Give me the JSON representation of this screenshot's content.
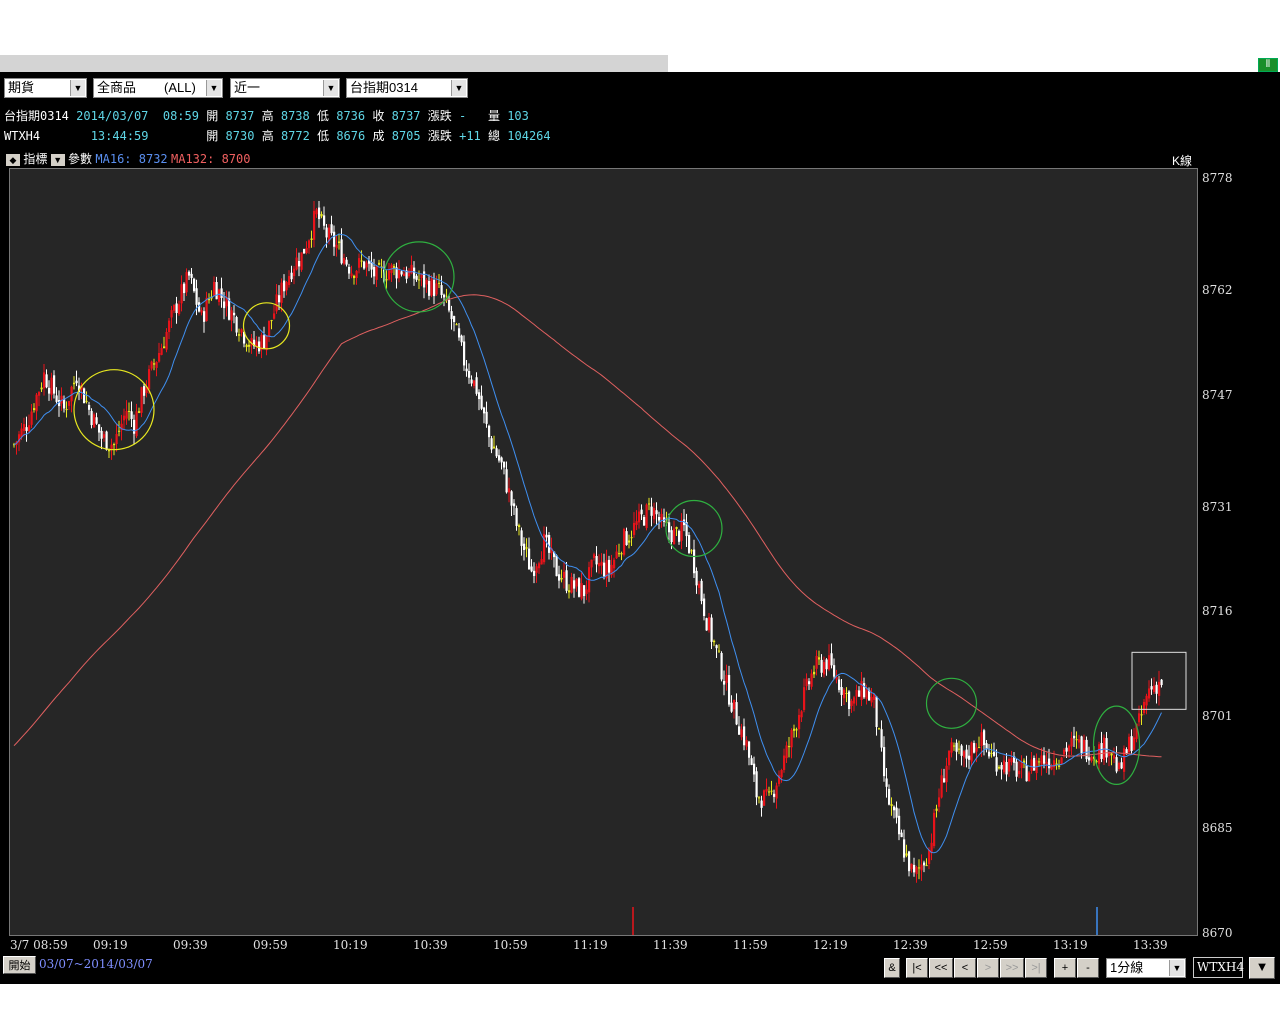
{
  "toolbar": {
    "market": "期貨",
    "commodity": "全商品",
    "commodity_scope": "(ALL)",
    "period": "近一",
    "symbol": "台指期0314"
  },
  "quote1": {
    "name": "台指期0314",
    "date": "2014/03/07",
    "time": "08:59",
    "open_label": "開",
    "open": "8737",
    "high_label": "高",
    "high": "8738",
    "low_label": "低",
    "low": "8736",
    "close_label": "收",
    "close": "8737",
    "change_label": "漲跌",
    "change": "-",
    "volume_label": "量",
    "volume": "103"
  },
  "quote2": {
    "name": "WTXH4",
    "time": "13:44:59",
    "open_label": "開",
    "open": "8730",
    "high_label": "高",
    "high": "8772",
    "low_label": "低",
    "low": "8676",
    "close_label": "成",
    "close": "8705",
    "change_label": "漲跌",
    "change": "+11",
    "volume_label": "總",
    "volume": "104264"
  },
  "indicator_bar": {
    "indicator_label": "指標",
    "param_label": "參數",
    "ma16": "MA16: 8732",
    "ma132": "MA132: 8700",
    "chart_kind": "K線"
  },
  "footer": {
    "start_label": "開始",
    "date_range": "03/07~2014/03/07",
    "amp": "&",
    "first": "|<",
    "fast_back": "<<",
    "back": "<",
    "fwd": ">",
    "fast_fwd": ">>",
    "last": ">|",
    "zoom_in": "+",
    "zoom_out": "-",
    "interval": "1分線",
    "symbol": "WTXH4",
    "down_arrow": "▼"
  },
  "colors": {
    "background": "#262626",
    "up": "#e8131a",
    "down": "#ffffff",
    "doji": "#e8e820",
    "ma16": "#3f8ff0",
    "ma132": "#e06060"
  },
  "chart_data": {
    "type": "candlestick",
    "title": "",
    "series": [
      {
        "name": "MA16"
      },
      {
        "name": "MA132"
      }
    ],
    "x_tick_labels": [
      "3/7 08:59",
      "09:19",
      "09:39",
      "09:59",
      "10:19",
      "10:39",
      "10:59",
      "11:19",
      "11:39",
      "11:59",
      "12:19",
      "12:39",
      "12:59",
      "13:19",
      "13:39"
    ],
    "y_tick_labels": [
      8778,
      8762,
      8747,
      8731,
      8716,
      8701,
      8685,
      8670
    ],
    "ylim": [
      8670,
      8778
    ],
    "grid": false,
    "close_path": [
      [
        0,
        8740
      ],
      [
        5,
        8743
      ],
      [
        12,
        8750
      ],
      [
        20,
        8745
      ],
      [
        25,
        8750
      ],
      [
        30,
        8745
      ],
      [
        35,
        8741
      ],
      [
        40,
        8740
      ],
      [
        45,
        8745
      ],
      [
        48,
        8743
      ],
      [
        52,
        8748
      ],
      [
        60,
        8755
      ],
      [
        65,
        8760
      ],
      [
        70,
        8764
      ],
      [
        75,
        8758
      ],
      [
        80,
        8763
      ],
      [
        85,
        8760
      ],
      [
        90,
        8757
      ],
      [
        95,
        8754
      ],
      [
        100,
        8755
      ],
      [
        105,
        8760
      ],
      [
        108,
        8763
      ],
      [
        112,
        8766
      ],
      [
        115,
        8767
      ],
      [
        118,
        8770
      ],
      [
        121,
        8773
      ],
      [
        125,
        8770
      ],
      [
        130,
        8768
      ],
      [
        135,
        8765
      ],
      [
        140,
        8766
      ],
      [
        145,
        8764
      ],
      [
        150,
        8765
      ],
      [
        155,
        8765
      ],
      [
        160,
        8764
      ],
      [
        165,
        8763
      ],
      [
        170,
        8762
      ],
      [
        175,
        8758
      ],
      [
        180,
        8752
      ],
      [
        185,
        8748
      ],
      [
        190,
        8741
      ],
      [
        195,
        8737
      ],
      [
        198,
        8733
      ],
      [
        202,
        8727
      ],
      [
        207,
        8722
      ],
      [
        212,
        8726
      ],
      [
        217,
        8722
      ],
      [
        222,
        8720
      ],
      [
        228,
        8719
      ],
      [
        232,
        8723
      ],
      [
        238,
        8722
      ],
      [
        243,
        8726
      ],
      [
        250,
        8729
      ],
      [
        255,
        8731
      ],
      [
        260,
        8728
      ],
      [
        265,
        8727
      ],
      [
        268,
        8728
      ],
      [
        272,
        8723
      ],
      [
        277,
        8715
      ],
      [
        282,
        8709
      ],
      [
        288,
        8702
      ],
      [
        293,
        8697
      ],
      [
        297,
        8690
      ],
      [
        302,
        8689
      ],
      [
        306,
        8693
      ],
      [
        310,
        8697
      ],
      [
        315,
        8703
      ],
      [
        320,
        8708
      ],
      [
        325,
        8709
      ],
      [
        330,
        8706
      ],
      [
        335,
        8703
      ],
      [
        340,
        8705
      ],
      [
        344,
        8703
      ],
      [
        349,
        8690
      ],
      [
        355,
        8683
      ],
      [
        360,
        8678
      ],
      [
        366,
        8682
      ],
      [
        370,
        8690
      ],
      [
        374,
        8696
      ],
      [
        380,
        8695
      ],
      [
        386,
        8698
      ],
      [
        392,
        8695
      ],
      [
        398,
        8694
      ],
      [
        404,
        8693
      ],
      [
        410,
        8695
      ],
      [
        416,
        8695
      ],
      [
        422,
        8697
      ],
      [
        427,
        8697
      ],
      [
        432,
        8696
      ],
      [
        438,
        8697
      ],
      [
        442,
        8693
      ],
      [
        446,
        8697
      ],
      [
        450,
        8700
      ],
      [
        454,
        8705
      ],
      [
        458,
        8706
      ]
    ],
    "annotations": [
      {
        "shape": "circle",
        "color": "#e8e820",
        "at": [
          40,
          8745
        ]
      },
      {
        "shape": "circle",
        "color": "#e8e820",
        "at": [
          101,
          8757
        ]
      },
      {
        "shape": "circle",
        "color": "#2fb040",
        "at": [
          162,
          8764
        ]
      },
      {
        "shape": "circle",
        "color": "#2fb040",
        "at": [
          272,
          8728
        ]
      },
      {
        "shape": "circle",
        "color": "#2fb040",
        "at": [
          375,
          8703
        ]
      },
      {
        "shape": "circle",
        "color": "#2fb040",
        "at": [
          441,
          8697
        ]
      },
      {
        "shape": "rect",
        "color": "#e0e0e0",
        "at": [
          452,
          8706
        ]
      }
    ]
  }
}
